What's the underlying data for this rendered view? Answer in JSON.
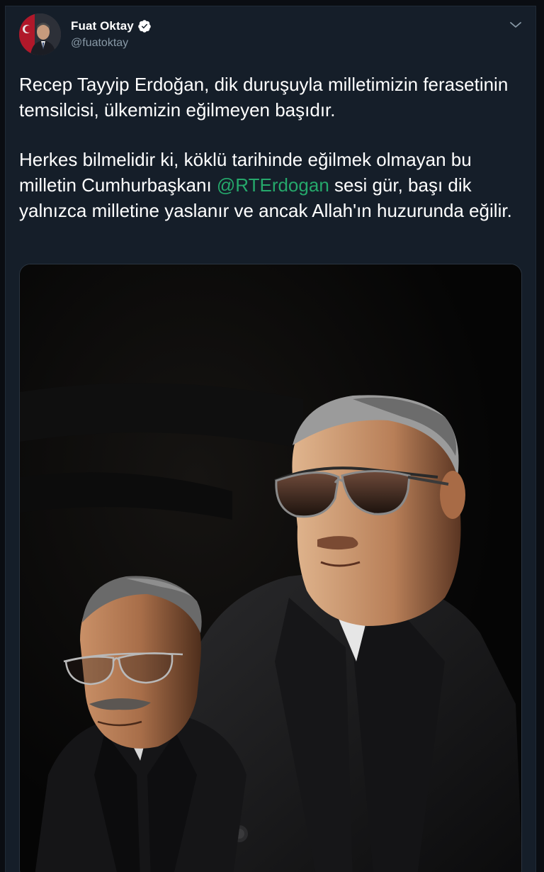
{
  "tweet": {
    "author": {
      "display_name": "Fuat Oktay",
      "handle": "@fuatoktay",
      "verified": true
    },
    "text_parts": {
      "paragraph1": "Recep Tayyip Erdoğan, dik duruşuyla milletimizin ferasetinin temsilcisi, ülkemizin eğilmeyen başıdır.",
      "paragraph2_before": "Herkes bilmelidir ki, köklü tarihinde eğilmek olmayan bu milletin Cumhurbaşkanı ",
      "mention": "@RTErdogan",
      "paragraph2_after": " sesi gür, başı dik yalnızca milletine yaslanır ve ancak Allah'ın huzurunda eğilir."
    },
    "media": {
      "type": "photo"
    }
  },
  "icons": {
    "verified": "verified-badge-icon",
    "menu": "chevron-down-icon"
  },
  "colors": {
    "background": "#151e29",
    "text": "#ffffff",
    "handle": "#8899a6",
    "mention": "#25a86b"
  }
}
